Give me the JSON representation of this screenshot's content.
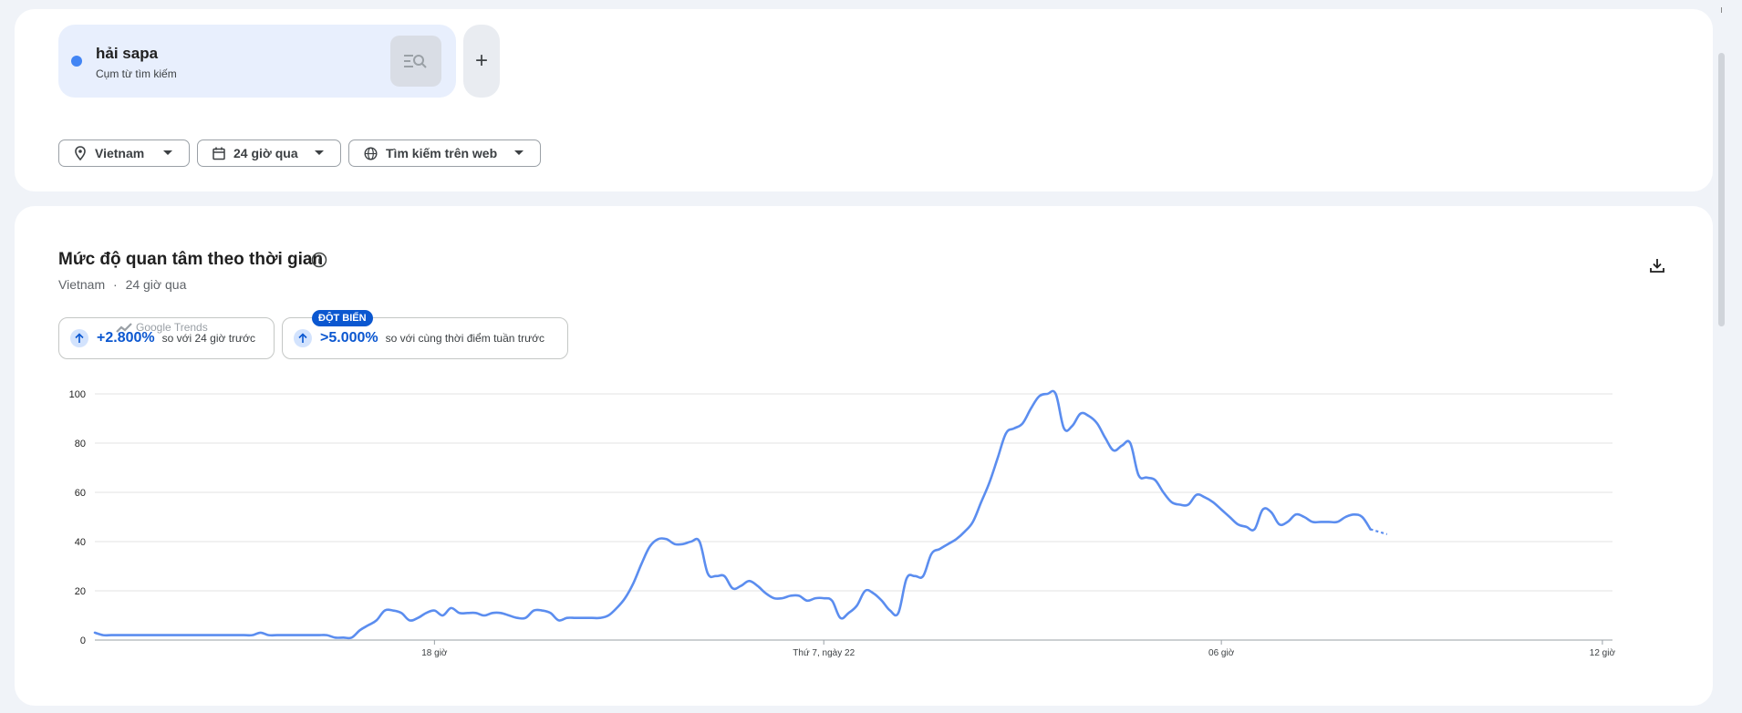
{
  "search_term": {
    "name": "hải sapa",
    "type_label": "Cụm từ tìm kiếm",
    "dot_color": "#4285f4"
  },
  "add_button_label": "+",
  "filters": {
    "location": "Vietnam",
    "time_range": "24 giờ qua",
    "property": "Tìm kiếm trên web"
  },
  "chart_header": {
    "title": "Mức độ quan tâm theo thời gian",
    "location": "Vietnam",
    "separator": "·",
    "time_range": "24 giờ qua"
  },
  "stats": [
    {
      "value": "+2.800%",
      "description": "so với 24 giờ trước"
    },
    {
      "value": ">5.000%",
      "description": "so với cùng thời điểm tuần trước",
      "badge": "ĐỘT BIẾN"
    }
  ],
  "watermark": "Google Trends",
  "chart_data": {
    "type": "line",
    "ylim": [
      0,
      100
    ],
    "yticks": [
      0,
      20,
      40,
      60,
      80,
      100
    ],
    "xlim": [
      0,
      183
    ],
    "xticks": [
      {
        "x": 41,
        "label": "18 giờ"
      },
      {
        "x": 88,
        "label": "Thứ 7, ngày 22"
      },
      {
        "x": 136,
        "label": "06 giờ"
      },
      {
        "x": 182,
        "label": "12 giờ"
      }
    ],
    "grid": true,
    "series": [
      {
        "color": "#5b8def",
        "values": [
          3,
          2,
          2,
          2,
          2,
          2,
          2,
          2,
          2,
          2,
          2,
          2,
          2,
          2,
          2,
          2,
          2,
          2,
          2,
          2,
          3,
          2,
          2,
          2,
          2,
          2,
          2,
          2,
          2,
          1,
          1,
          1,
          4,
          6,
          8,
          12,
          12,
          11,
          8,
          9,
          11,
          12,
          10,
          13,
          11,
          11,
          11,
          10,
          11,
          11,
          10,
          9,
          9,
          12,
          12,
          11,
          8,
          9,
          9,
          9,
          9,
          9,
          10,
          13,
          17,
          23,
          31,
          38,
          41,
          41,
          39,
          39,
          40,
          40,
          27,
          26,
          26,
          21,
          22,
          24,
          22,
          19,
          17,
          17,
          18,
          18,
          16,
          17,
          17,
          16,
          9,
          11,
          14,
          20,
          19,
          16,
          12,
          11,
          25,
          26,
          26,
          35,
          37,
          39,
          41,
          44,
          48,
          56,
          64,
          74,
          84,
          86,
          88,
          94,
          99,
          100,
          100,
          86,
          87,
          92,
          91,
          88,
          82,
          77,
          79,
          80,
          67,
          66,
          65,
          60,
          56,
          55,
          55,
          59,
          58,
          56,
          53,
          50,
          47,
          46,
          45,
          53,
          52,
          47,
          48,
          51,
          50,
          48,
          48,
          48,
          48,
          50,
          51,
          50,
          45
        ],
        "projected": [
          45,
          44,
          43
        ]
      }
    ]
  }
}
